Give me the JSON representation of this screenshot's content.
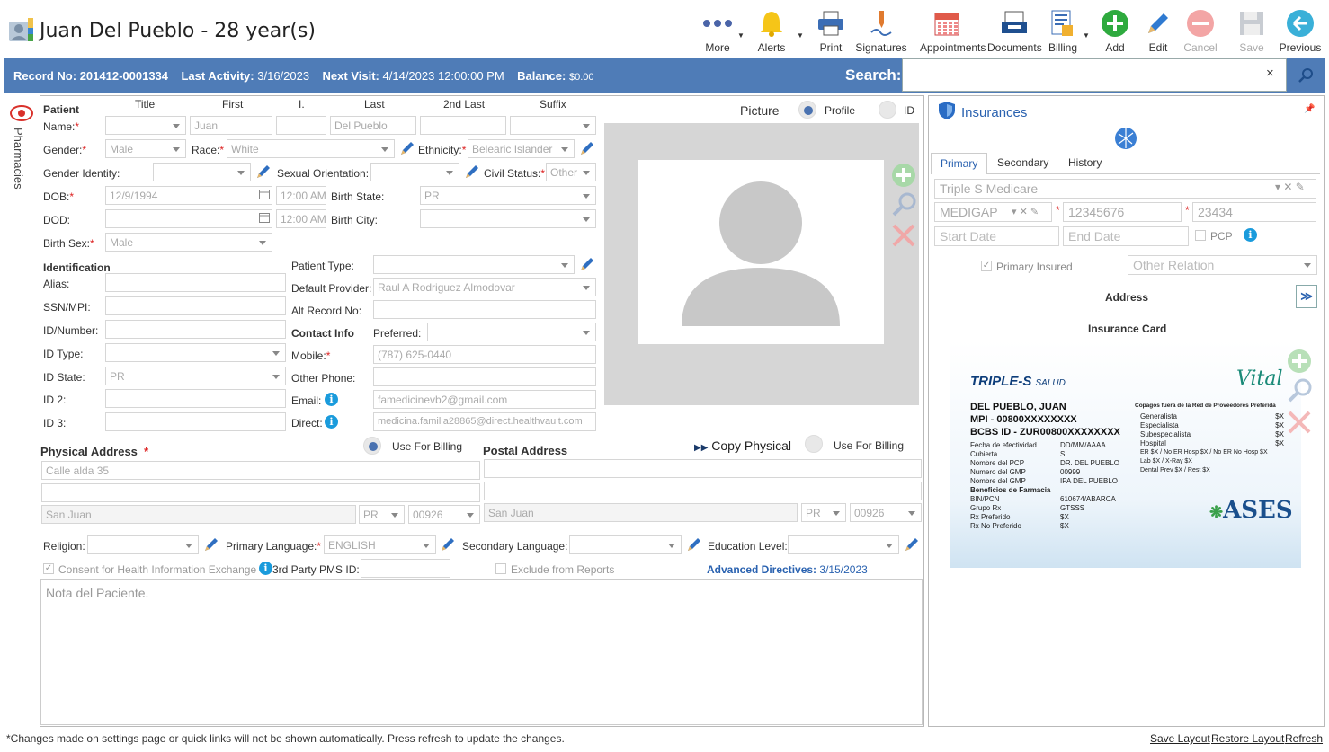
{
  "header": {
    "patient_title": "Juan Del Pueblo - 28 year(s)",
    "toolbar": [
      {
        "label": "More",
        "icon": "more-dots-icon"
      },
      {
        "label": "Alerts",
        "icon": "bell-icon"
      },
      {
        "label": "Print",
        "icon": "printer-icon"
      },
      {
        "label": "Signatures",
        "icon": "signature-icon"
      },
      {
        "label": "Appointments",
        "icon": "calendar-icon"
      },
      {
        "label": "Documents",
        "icon": "documents-tray-icon"
      },
      {
        "label": "Billing",
        "icon": "billing-icon"
      },
      {
        "label": "Add",
        "icon": "add-icon"
      },
      {
        "label": "Edit",
        "icon": "pencil-icon"
      },
      {
        "label": "Cancel",
        "icon": "cancel-icon"
      },
      {
        "label": "Save",
        "icon": "save-icon"
      },
      {
        "label": "Previous",
        "icon": "back-arrow-icon"
      }
    ]
  },
  "infobar": {
    "record_label": "Record No:",
    "record_value": "201412-0001334",
    "activity_label": "Last Activity:",
    "activity_value": "3/16/2023",
    "visit_label": "Next Visit:",
    "visit_value": "4/14/2023 12:00:00 PM",
    "balance_label": "Balance:",
    "balance_value": "$0.00",
    "search_label": "Search:",
    "clear": "×"
  },
  "sidebar": {
    "pharmacies": "Pharmacies"
  },
  "patient": {
    "section": "Patient",
    "cols": {
      "title": "Title",
      "first": "First",
      "initial": "I.",
      "last": "Last",
      "second_last": "2nd Last",
      "suffix": "Suffix"
    },
    "labels": {
      "name": "Name:",
      "gender": "Gender:",
      "race": "Race:",
      "ethnicity": "Ethnicity:",
      "gender_identity": "Gender Identity:",
      "sexual_orientation": "Sexual Orientation:",
      "civil_status": "Civil Status:",
      "dob": "DOB:",
      "birth_state": "Birth State:",
      "dod": "DOD:",
      "birth_city": "Birth City:",
      "birth_sex": "Birth Sex:"
    },
    "values": {
      "first": "Juan",
      "last": "Del Pueblo",
      "gender": "Male",
      "race": "White",
      "ethnicity": "Belearic Islander",
      "civil_status": "Other",
      "dob": "12/9/1994",
      "dob_time": "12:00 AM",
      "birth_state": "PR",
      "dod_time": "12:00 AM",
      "birth_sex": "Male"
    },
    "req": "*"
  },
  "identification": {
    "section": "Identification",
    "labels": {
      "alias": "Alias:",
      "ssn": "SSN/MPI:",
      "id_number": "ID/Number:",
      "id_type": "ID Type:",
      "id_state": "ID State:",
      "id2": "ID 2:",
      "id3": "ID 3:",
      "patient_type": "Patient Type:",
      "default_provider": "Default Provider:",
      "alt_record": "Alt Record No:"
    },
    "values": {
      "id_state": "PR",
      "default_provider": "Raul A Rodriguez Almodovar"
    }
  },
  "contact": {
    "section": "Contact Info",
    "labels": {
      "preferred": "Preferred:",
      "mobile": "Mobile:",
      "other_phone": "Other Phone:",
      "email": "Email:",
      "direct": "Direct:"
    },
    "values": {
      "mobile": "(787) 625-0440",
      "email": "famedicinevb2@gmail.com",
      "direct": "medicina.familia28865@direct.healthvault.com"
    }
  },
  "picture": {
    "label": "Picture",
    "profile": "Profile",
    "id": "ID"
  },
  "physical_address": {
    "title": "Physical Address",
    "use_billing": "Use For Billing",
    "line1": "Calle alda 35",
    "city": "San Juan",
    "state": "PR",
    "zip": "00926"
  },
  "postal_address": {
    "title": "Postal Address",
    "copy": "Copy Physical",
    "use_billing": "Use For Billing",
    "city": "San Juan",
    "state": "PR",
    "zip": "00926"
  },
  "misc": {
    "religion": "Religion:",
    "primary_language": "Primary Language:",
    "primary_language_value": "ENGLISH",
    "secondary_language": "Secondary Language:",
    "education": "Education Level:",
    "consent": "Consent for Health Information Exchange",
    "third_party": "3rd Party PMS ID:",
    "exclude": "Exclude from Reports",
    "adv_dir_label": "Advanced Directives:",
    "adv_dir_value": "3/15/2023",
    "notes_placeholder": "Nota del Paciente."
  },
  "insurance": {
    "title": "Insurances",
    "tabs": [
      "Primary",
      "Secondary",
      "History"
    ],
    "plan": "Triple S Medicare",
    "type": "MEDIGAP",
    "member_id": "12345676",
    "group": "23434",
    "start_placeholder": "Start Date",
    "end_placeholder": "End Date",
    "pcp": "PCP",
    "primary_insured": "Primary Insured",
    "other_relation": "Other Relation",
    "address": "Address",
    "card_title": "Insurance Card",
    "card": {
      "brand": "TRIPLE-S",
      "brand_sub": "SALUD",
      "vital": "Vital",
      "name": "DEL PUEBLO, JUAN",
      "mpi": "MPI - 00800XXXXXXXX",
      "bcbs": "BCBS ID - ZUR00800XXXXXXXX",
      "rows": [
        [
          "Fecha de efectividad",
          "DD/MM/AAAA"
        ],
        [
          "Cubierta",
          "S"
        ],
        [
          "Nombre del PCP",
          "DR. DEL PUEBLO"
        ],
        [
          "Numero del GMP",
          "00999"
        ],
        [
          "Nombre del GMP",
          "IPA DEL PUEBLO"
        ]
      ],
      "pharm_title": "Beneficios de Farmacia",
      "pharm_rows": [
        [
          "BIN/PCN",
          "610674/ABARCA"
        ],
        [
          "Grupo Rx",
          "GTSSS"
        ],
        [
          "Rx Preferido",
          "$X"
        ],
        [
          "Rx No Preferido",
          "$X"
        ]
      ],
      "copay_title": "Copagos fuera de la Red de Proveedores Preferida",
      "copays": [
        [
          "Generalista",
          "$X"
        ],
        [
          "Especialista",
          "$X"
        ],
        [
          "Subespecialista",
          "$X"
        ],
        [
          "Hospital",
          "$X"
        ]
      ],
      "copay_extra": [
        "ER $X / No ER Hosp $X / No ER No Hosp $X",
        "Lab $X / X-Ray $X",
        "Dental Prev $X / Rest $X"
      ],
      "ases": "ASES"
    }
  },
  "footer": {
    "note": "*Changes made on settings page or quick links will not be shown automatically. Press refresh to update the changes.",
    "save_layout": "Save Layout",
    "restore_layout": "Restore Layout",
    "refresh": "Refresh"
  }
}
